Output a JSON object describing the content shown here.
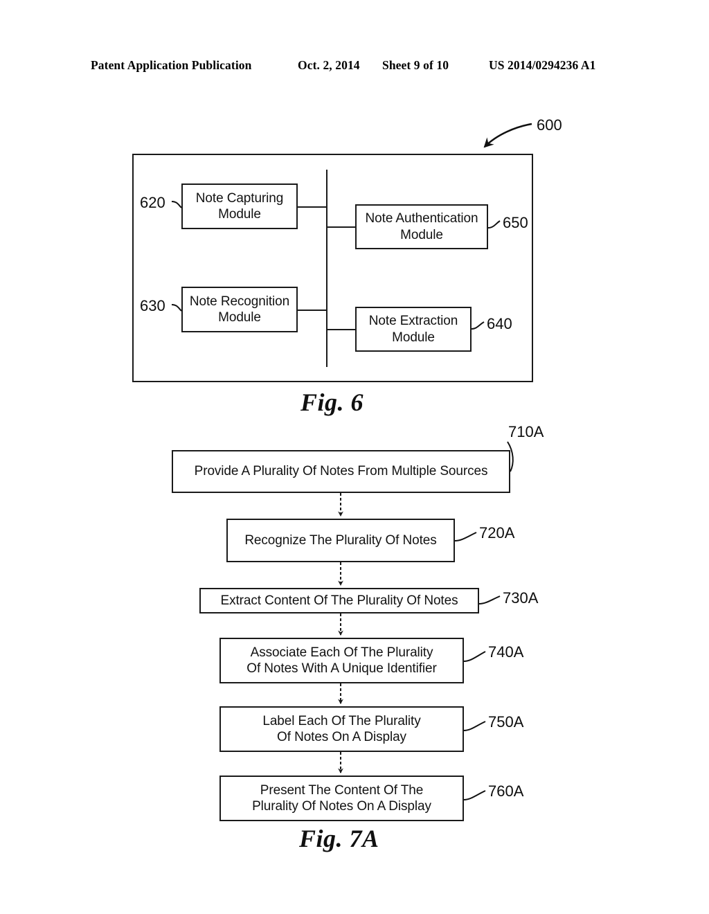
{
  "header": {
    "publication": "Patent Application Publication",
    "date": "Oct. 2, 2014",
    "sheet": "Sheet 9 of 10",
    "patent_number": "US 2014/0294236 A1"
  },
  "figures": [
    {
      "id": "fig6",
      "caption": "Fig. 6",
      "system_ref": "600",
      "blocks": [
        {
          "ref": "620",
          "label": "Note Capturing\nModule",
          "line1": "Note Capturing",
          "line2": "Module"
        },
        {
          "ref": "650",
          "label": "Note Authentication\nModule",
          "line1": "Note Authentication",
          "line2": "Module"
        },
        {
          "ref": "630",
          "label": "Note Recognition\nModule",
          "line1": "Note Recognition",
          "line2": "Module"
        },
        {
          "ref": "640",
          "label": "Note Extraction\nModule",
          "line1": "Note Extraction",
          "line2": "Module"
        }
      ]
    },
    {
      "id": "fig7a",
      "caption": "Fig. 7A",
      "steps": [
        {
          "ref": "710A",
          "line1": "Provide A Plurality Of Notes From Multiple Sources",
          "line2": ""
        },
        {
          "ref": "720A",
          "line1": "Recognize The Plurality Of Notes",
          "line2": ""
        },
        {
          "ref": "730A",
          "line1": "Extract Content Of The Plurality Of Notes",
          "line2": ""
        },
        {
          "ref": "740A",
          "line1": "Associate Each Of The Plurality",
          "line2": "Of Notes With A Unique Identifier"
        },
        {
          "ref": "750A",
          "line1": "Label Each Of The Plurality",
          "line2": "Of Notes On A Display"
        },
        {
          "ref": "760A",
          "line1": "Present The Content Of The",
          "line2": "Plurality Of Notes On A Display"
        }
      ]
    }
  ],
  "colors": {
    "ink": "#121212",
    "paper": "#ffffff",
    "line": "#1a1a1a"
  }
}
